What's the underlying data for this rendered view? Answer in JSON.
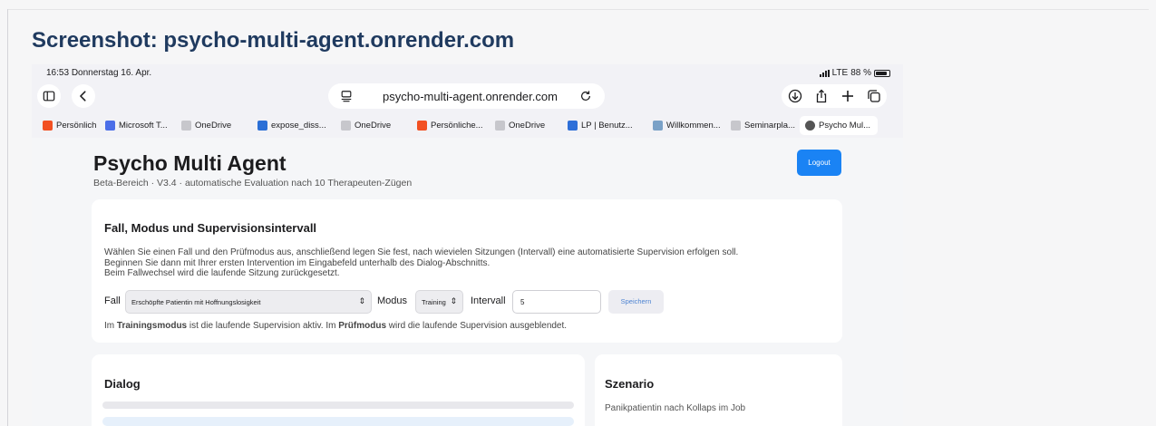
{
  "caption": "Screenshot: psycho-multi-agent.onrender.com",
  "status": {
    "time": "16:53",
    "date": "Donnerstag 16. Apr.",
    "network": "LTE",
    "battery": "88 %"
  },
  "toolbar": {
    "url": "psycho-multi-agent.onrender.com",
    "icons": [
      "sidebar-icon",
      "back-icon",
      "reader-icon",
      "reload-icon",
      "download-icon",
      "share-icon",
      "plus-icon",
      "tabs-icon"
    ]
  },
  "tabs": [
    {
      "label": "Persönliche",
      "color": "#f25022"
    },
    {
      "label": "Microsoft T...",
      "color": "#4b6ee8"
    },
    {
      "label": "OneDrive",
      "color": "#c7c7cc"
    },
    {
      "label": "expose_diss...",
      "color": "#2b6fd6"
    },
    {
      "label": "OneDrive",
      "color": "#c7c7cc"
    },
    {
      "label": "Persönliche...",
      "color": "#f25022"
    },
    {
      "label": "OneDrive",
      "color": "#c7c7cc"
    },
    {
      "label": "LP | Benutz...",
      "color": "#2e6fd8"
    },
    {
      "label": "Willkommen...",
      "color": "#7aa1c7"
    },
    {
      "label": "Seminarpla...",
      "color": "#c7c7cc"
    },
    {
      "label": "Psycho Mul...",
      "color": "#555555"
    }
  ],
  "page": {
    "title": "Psycho Multi Agent",
    "subtitle": "Beta-Bereich · V3.4 · automatische Evaluation nach 10 Therapeuten-Zügen",
    "logout_label": "Logout"
  },
  "config_card": {
    "title": "Fall, Modus und Supervisionsintervall",
    "desc_line1": "Wählen Sie einen Fall und den Prüfmodus aus, anschließend legen Sie fest, nach wievielen Sitzungen (Intervall) eine automatisierte Supervision erfolgen soll.",
    "desc_line2": "Beginnen Sie dann mit Ihrer ersten Intervention im Eingabefeld unterhalb des Dialog-Abschnitts.",
    "desc_line3": "Beim Fallwechsel wird die laufende Sitzung zurückgesetzt.",
    "fall_label": "Fall",
    "fall_value": "Erschöpfte Patientin mit Hoffnungslosigkeit",
    "modus_label": "Modus",
    "modus_value": "Training",
    "intervall_label": "Intervall",
    "intervall_value": "5",
    "save_label": "Speichern",
    "note_1": "Im ",
    "note_b1": "Trainingsmodus",
    "note_2": " ist die laufende Supervision aktiv. Im ",
    "note_b2": "Prüfmodus",
    "note_3": " wird die laufende Supervision ausgeblendet."
  },
  "dialog_card": {
    "title": "Dialog"
  },
  "scenario_card": {
    "title": "Szenario",
    "text": "Panikpatientin nach Kollaps im Job"
  }
}
